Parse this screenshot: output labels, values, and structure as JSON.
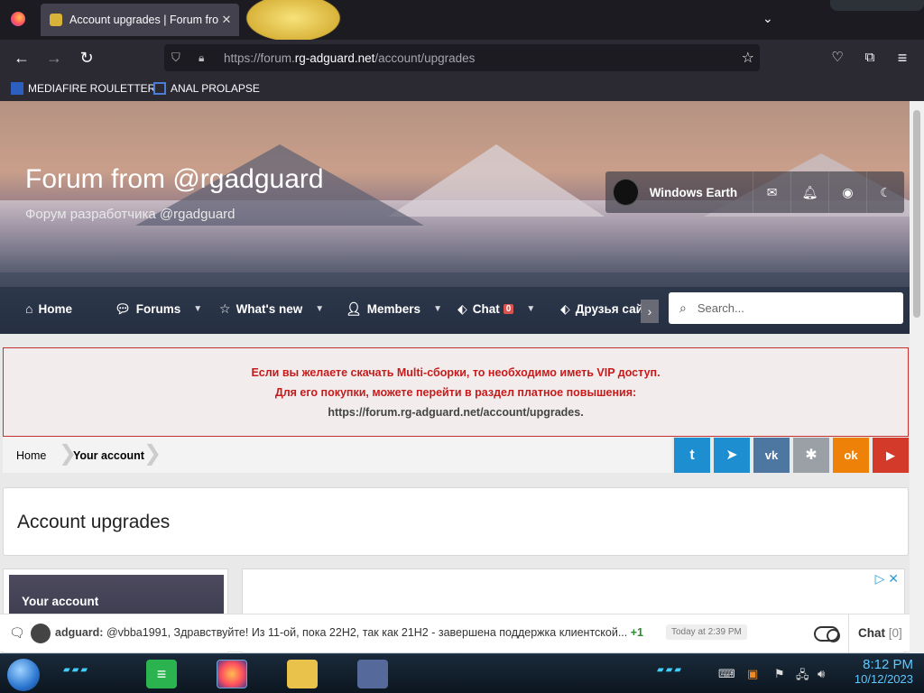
{
  "browser": {
    "tab_title": "Account upgrades | Forum from @rgadguard",
    "tab_close": "✕",
    "url_prefix": "https://forum.",
    "url_domain": "rg-adguard.net",
    "url_path": "/account/upgrades",
    "bookmarks": [
      "MEDIAFIRE ROULETTER",
      "ANAL PROLAPSE"
    ]
  },
  "site": {
    "title": "Forum from @rgadguard",
    "subtitle": "Форум разработчика @rgadguard",
    "user_name": "Windows Earth"
  },
  "nav": {
    "items": [
      {
        "label": "Home"
      },
      {
        "label": "Forums"
      },
      {
        "label": "What's new"
      },
      {
        "label": "Members"
      },
      {
        "label": "Chat"
      },
      {
        "label": "Друзья сай"
      }
    ],
    "chat_badge": "0",
    "search_placeholder": "Search..."
  },
  "notice": {
    "line1": "Если вы желаете скачать Multi-сборки, то необходимо иметь VIP доступ.",
    "line2": "Для его покупки, можете перейти в раздел платное повышения:",
    "line3": "https://forum.rg-adguard.net/account/upgrades."
  },
  "breadcrumb": {
    "home": "Home",
    "current": "Your account"
  },
  "share": [
    {
      "name": "twitter",
      "glyph": "t",
      "color": "#1d8ecf"
    },
    {
      "name": "telegram",
      "glyph": "➤",
      "color": "#1d8ecf"
    },
    {
      "name": "vk",
      "glyph": "vk",
      "color": "#4d76a1"
    },
    {
      "name": "other",
      "glyph": "✱",
      "color": "#9aa0a6"
    },
    {
      "name": "odnoklassniki",
      "glyph": "ok",
      "color": "#ee8208"
    },
    {
      "name": "youtube",
      "glyph": "▶",
      "color": "#d43a2a"
    }
  ],
  "page": {
    "heading": "Account upgrades",
    "sidebar_label": "Your account"
  },
  "chat": {
    "author": "adguard:",
    "message": "@vbba1991, Здравствуйте! Из 11-ой, пока 22H2, так как 21H2 - завершена поддержка клиентской...",
    "plus": "+1",
    "time": "Today at 2:39 PM",
    "label": "Chat",
    "count": "[0]"
  },
  "taskbar": {
    "time": "8:12 PM",
    "date": "10/12/2023"
  }
}
